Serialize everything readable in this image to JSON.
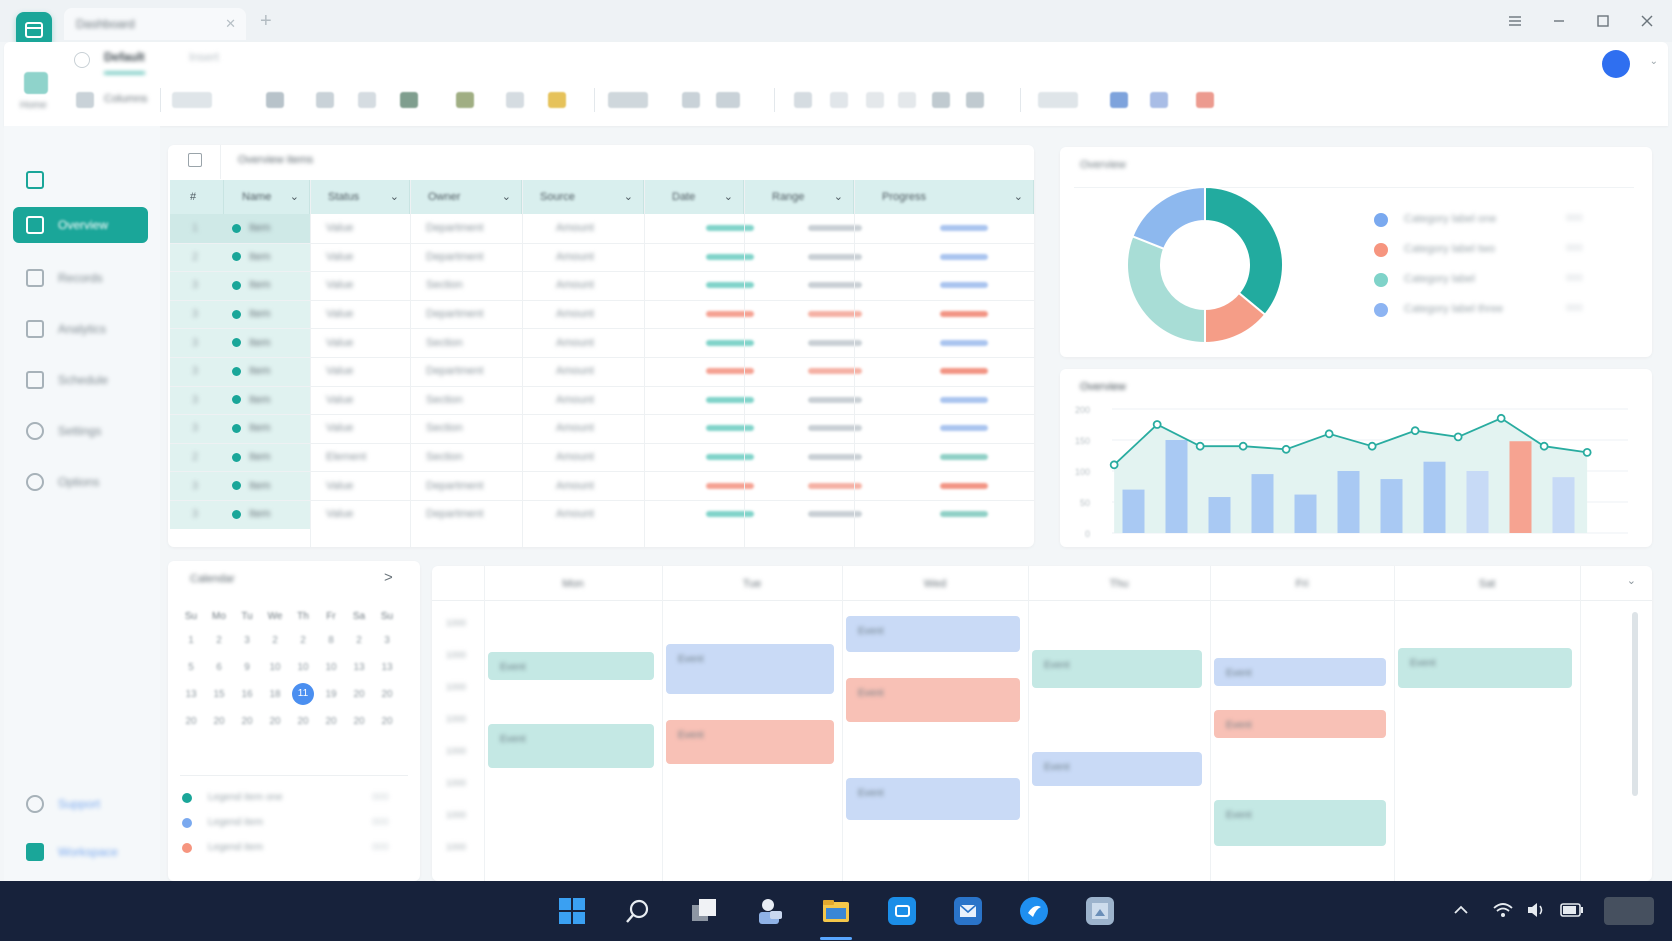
{
  "window": {
    "tab_title": "Dashboard",
    "new_tab": "+",
    "controls": [
      "menu-icon",
      "minimize-icon",
      "maximize-icon",
      "close-icon"
    ]
  },
  "ribbon": {
    "app_label": "Home",
    "tabs": [
      "File",
      "Default",
      "Insert"
    ],
    "active_tab": "Default",
    "first_tool_label": "Columns"
  },
  "sidebar": {
    "items": [
      {
        "label": "",
        "icon": "grid-icon"
      },
      {
        "label": "Overview",
        "icon": "dashboard-icon",
        "active": true
      },
      {
        "label": "Records",
        "icon": "table-icon"
      },
      {
        "label": "Analytics",
        "icon": "chart-icon"
      },
      {
        "label": "Schedule",
        "icon": "calendar-icon"
      },
      {
        "label": "Settings",
        "icon": "gear-icon"
      },
      {
        "label": "Options",
        "icon": "gear-icon"
      }
    ],
    "footer": [
      {
        "label": "Support",
        "icon": "chat-icon"
      },
      {
        "label": "Workspace",
        "icon": "app-icon"
      }
    ]
  },
  "grid": {
    "title": "Overview items",
    "columns": [
      "#",
      "Name",
      "Status",
      "Owner",
      "Source",
      "Date",
      "Range",
      "Progress"
    ],
    "rows": [
      {
        "n": "1",
        "name": "Item",
        "c1": "Value",
        "c2": "Department",
        "c3": "Amount"
      },
      {
        "n": "2",
        "name": "Item",
        "c1": "Value",
        "c2": "Department",
        "c3": "Amount"
      },
      {
        "n": "3",
        "name": "Item",
        "c1": "Value",
        "c2": "Section",
        "c3": "Amount"
      },
      {
        "n": "3",
        "name": "Item",
        "c1": "Value",
        "c2": "Department",
        "c3": "Amount"
      },
      {
        "n": "3",
        "name": "Item",
        "c1": "Value",
        "c2": "Section",
        "c3": "Amount"
      },
      {
        "n": "3",
        "name": "Item",
        "c1": "Value",
        "c2": "Department",
        "c3": "Amount"
      },
      {
        "n": "3",
        "name": "Item",
        "c1": "Value",
        "c2": "Section",
        "c3": "Amount"
      },
      {
        "n": "3",
        "name": "Item",
        "c1": "Value",
        "c2": "Section",
        "c3": "Amount"
      },
      {
        "n": "2",
        "name": "Item",
        "c1": "Element",
        "c2": "Section",
        "c3": "Amount"
      },
      {
        "n": "3",
        "name": "Item",
        "c1": "Value",
        "c2": "Department",
        "c3": "Amount"
      },
      {
        "n": "3",
        "name": "Item",
        "c1": "Value",
        "c2": "Department",
        "c3": "Amount"
      }
    ],
    "statuses": [
      "teal",
      "teal",
      "teal",
      "red",
      "teal",
      "red",
      "teal",
      "teal",
      "teal",
      "red",
      "teal"
    ]
  },
  "donut": {
    "title": "Overview",
    "legend": [
      {
        "label": "Category label one",
        "value": "000",
        "color": "#7aa9ef"
      },
      {
        "label": "Category label two",
        "value": "000",
        "color": "#f6957f"
      },
      {
        "label": "Category label",
        "value": "000",
        "color": "#7fd3c9"
      },
      {
        "label": "Category label three",
        "value": "000",
        "color": "#8db4f2"
      }
    ]
  },
  "trend": {
    "title": "Overview",
    "yticks": [
      "200",
      "150",
      "100",
      "50",
      "0"
    ]
  },
  "calendar": {
    "title": "Calendar",
    "next": ">",
    "weekdays": [
      "Su",
      "Mo",
      "Tu",
      "We",
      "Th",
      "Fr",
      "Sa",
      "Su"
    ],
    "weeks": [
      [
        "1",
        "2",
        "3",
        "2",
        "2",
        "8",
        "2",
        "3"
      ],
      [
        "5",
        "6",
        "9",
        "10",
        "10",
        "10",
        "13",
        "13"
      ],
      [
        "13",
        "15",
        "16",
        "18",
        "11",
        "19",
        "20",
        "20"
      ],
      [
        "20",
        "20",
        "20",
        "20",
        "20",
        "20",
        "20",
        "20"
      ]
    ],
    "today": "11",
    "legend": [
      {
        "label": "Legend item one",
        "value": "000",
        "color": "#1aa699"
      },
      {
        "label": "Legend item",
        "value": "000",
        "color": "#7aa9ef"
      },
      {
        "label": "Legend item",
        "value": "000",
        "color": "#f6957f"
      }
    ]
  },
  "schedule": {
    "days": [
      "Mon",
      "Tue",
      "Wed",
      "Thu",
      "Fri",
      "Sat"
    ],
    "times": [
      "1000",
      "1000",
      "1000",
      "1000",
      "1000",
      "1000",
      "1000",
      "1000"
    ],
    "event_label": "Event",
    "collapse": "v"
  },
  "taskbar": {
    "apps": [
      "start-icon",
      "search-icon",
      "task-view-icon",
      "teams-icon",
      "file-explorer-icon",
      "store-icon",
      "mail-icon",
      "browser-icon",
      "photos-icon"
    ]
  },
  "chart_data": [
    {
      "type": "pie",
      "title": "",
      "categories": [
        "Teal",
        "Coral",
        "Mint",
        "Blue"
      ],
      "values": [
        36,
        14,
        31,
        19
      ],
      "colors": [
        "#22ab9f",
        "#f59d87",
        "#a8ddd6",
        "#8db8ee"
      ]
    },
    {
      "type": "bar",
      "title": "",
      "categories": [
        "1",
        "2",
        "3",
        "4",
        "5",
        "6",
        "7",
        "8",
        "9",
        "10",
        "11",
        "12"
      ],
      "ylim": [
        0,
        200
      ],
      "bars": [
        70,
        150,
        58,
        95,
        62,
        100,
        87,
        115,
        100,
        148,
        90,
        0
      ],
      "line": [
        110,
        175,
        140,
        140,
        135,
        160,
        140,
        165,
        155,
        185,
        140,
        130
      ],
      "bar_colors": [
        "#a9c9f3",
        "#a9c9f3",
        "#a9c9f3",
        "#a9c9f3",
        "#a9c9f3",
        "#a9c9f3",
        "#a9c9f3",
        "#a9c9f3",
        "#c7daf6",
        "#f6a391",
        "#c7daf6",
        "#c7daf6"
      ],
      "line_color": "#29aca0"
    }
  ]
}
